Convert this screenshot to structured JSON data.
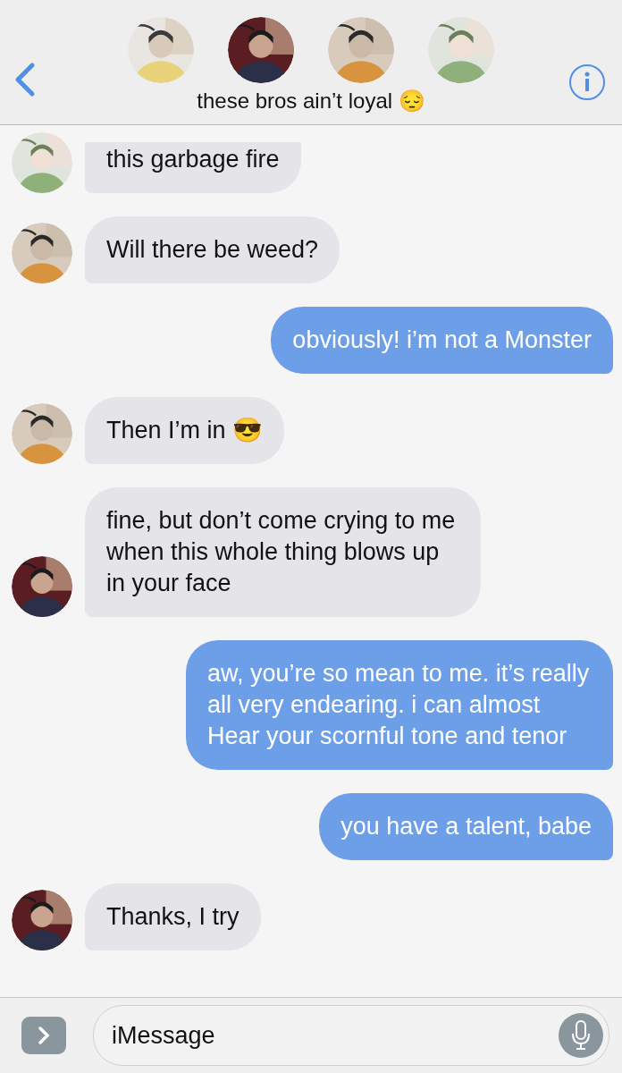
{
  "header": {
    "title": "these bros ain’t loyal 😔"
  },
  "messages": [
    {
      "kind": "received",
      "text": "this garbage fire"
    },
    {
      "kind": "received",
      "text": "Will there be weed?"
    },
    {
      "kind": "sent",
      "text": "obviously! i’m not a Monster"
    },
    {
      "kind": "received",
      "text": "Then I’m in 😎"
    },
    {
      "kind": "received",
      "text": "fine, but don’t come crying to me when this whole thing blows up in your face"
    },
    {
      "kind": "sent",
      "text": "aw, you’re so mean to me. it’s really all very endearing. i can almost Hear your scornful tone and tenor"
    },
    {
      "kind": "sent",
      "text": "you have a talent, babe"
    },
    {
      "kind": "received",
      "text": "Thanks, I try"
    }
  ],
  "composer": {
    "placeholder": "iMessage"
  }
}
